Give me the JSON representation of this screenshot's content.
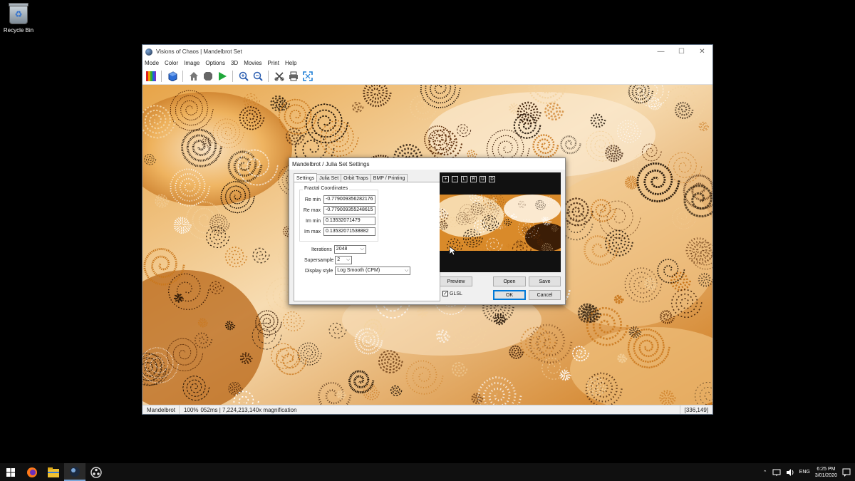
{
  "desktop": {
    "recycle_bin_label": "Recycle Bin"
  },
  "window": {
    "title": "Visions of Chaos | Mandelbrot Set",
    "minimize": "—",
    "maximize": "☐",
    "close": "✕"
  },
  "menu": [
    "Mode",
    "Color",
    "Image",
    "Options",
    "3D",
    "Movies",
    "Print",
    "Help"
  ],
  "toolbar_icons": [
    "palette-icon",
    "cube-icon",
    "home-icon",
    "stop-icon",
    "play-icon",
    "zoom-in-icon",
    "zoom-out-icon",
    "crop-icon",
    "print-icon",
    "fullscreen-icon"
  ],
  "status": {
    "mode": "Mandelbrot",
    "zoom": "100%",
    "info": "052ms | 7,224,213,140x magnification",
    "coords": "[336,149]"
  },
  "dialog": {
    "title": "Mandelbrot / Julia Set Settings",
    "tabs": [
      "Settings",
      "Julia Set",
      "Orbit Traps",
      "BMP / Printing"
    ],
    "group_title": "Fractal Coordinates",
    "re_min_label": "Re min",
    "re_min": "-0.779009356282176",
    "re_max_label": "Re max",
    "re_max": "-0.779009355248615",
    "im_min_label": "Im min",
    "im_min": "0.13532071479",
    "im_max_label": "Im max",
    "im_max": "0.13532071538882",
    "iterations_label": "Iterations",
    "iterations": "2048",
    "supersample_label": "Supersample",
    "supersample": "2",
    "display_style_label": "Display style",
    "display_style": "Log Smooth (CPM)",
    "nav_buttons": [
      "+",
      "-",
      "L",
      "R",
      "U",
      "D"
    ],
    "preview_button": "Preview",
    "open_button": "Open",
    "save_button": "Save",
    "glsl_label": "GLSL",
    "glsl_checked": true,
    "ok_button": "OK",
    "cancel_button": "Cancel"
  },
  "taskbar": {
    "items": [
      "windows-start-icon",
      "firefox-icon",
      "file-explorer-icon",
      "visions-of-chaos-icon",
      "obs-icon"
    ],
    "language": "ENG",
    "time": "6:25 PM",
    "date": "3/01/2020"
  },
  "colors": {
    "fractal_light": "#f6e4c8",
    "fractal_mid": "#e39a36",
    "fractal_dark": "#4a2608",
    "accent": "#0078d7"
  }
}
